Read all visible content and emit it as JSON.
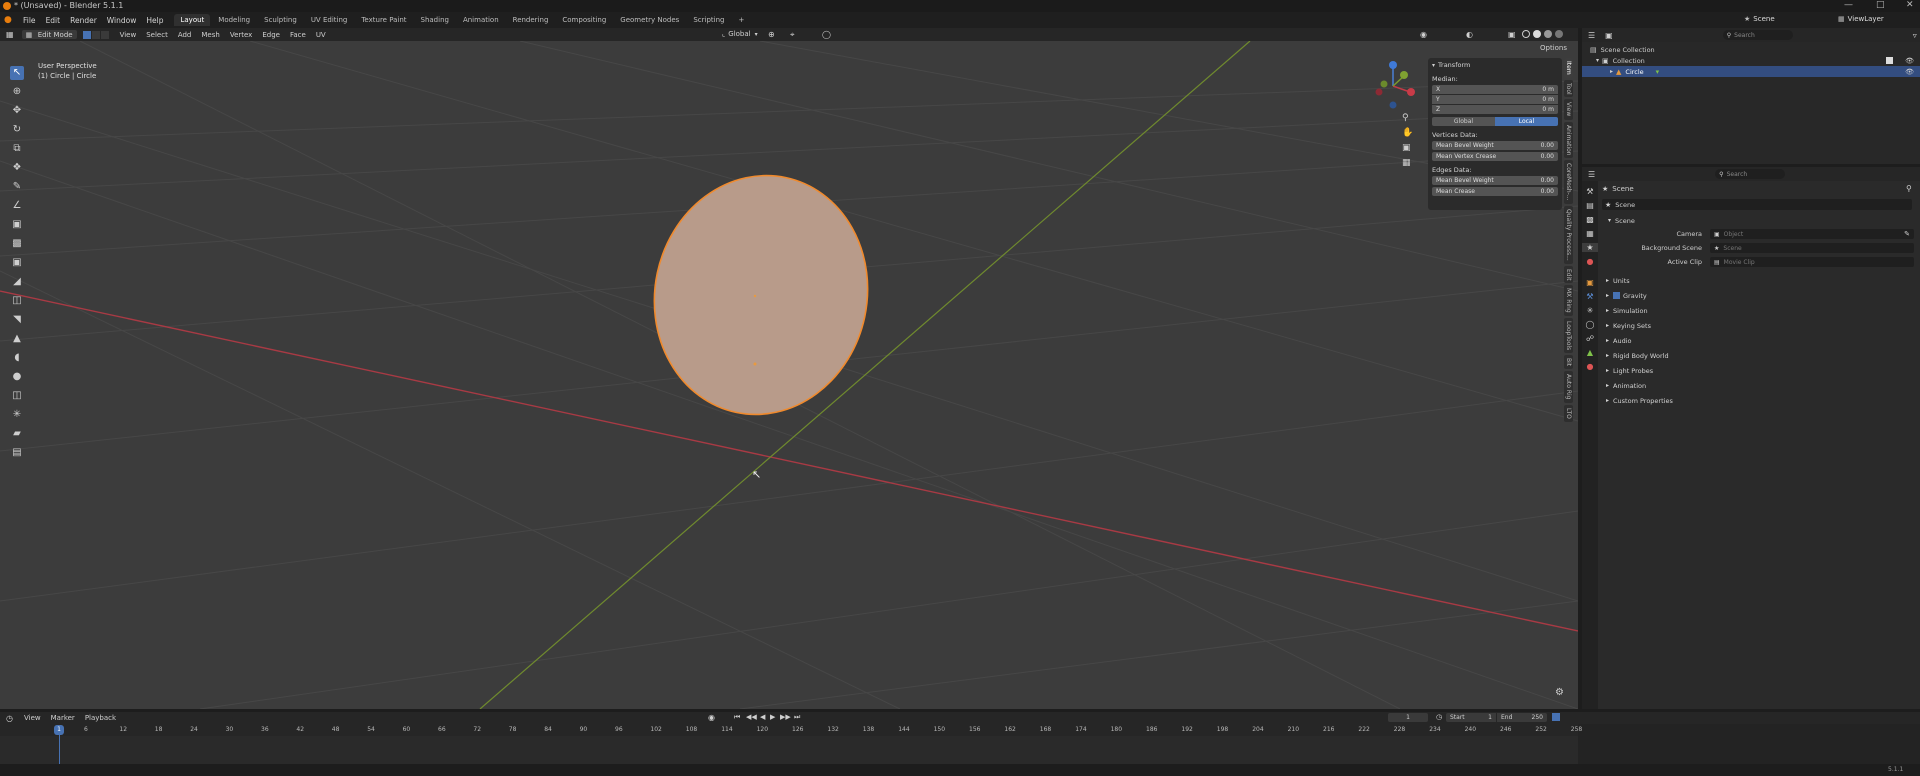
{
  "title": "* (Unsaved) - Blender 5.1.1",
  "menu": [
    "File",
    "Edit",
    "Render",
    "Window",
    "Help"
  ],
  "workspaces": [
    "Layout",
    "Modeling",
    "Sculpting",
    "UV Editing",
    "Texture Paint",
    "Shading",
    "Animation",
    "Rendering",
    "Compositing",
    "Geometry Nodes",
    "Scripting"
  ],
  "scene_field": "Scene",
  "viewlayer_field": "ViewLayer",
  "viewport_header": {
    "mode": "Edit Mode",
    "menus": [
      "View",
      "Select",
      "Add",
      "Mesh",
      "Vertex",
      "Edge",
      "Face",
      "UV"
    ],
    "orientation": "Global",
    "options": "Options"
  },
  "viewport_info": {
    "perspective": "User Perspective",
    "object": "(1) Circle | Circle"
  },
  "npanel": {
    "header": "Transform",
    "median": "Median:",
    "fields": [
      {
        "label": "X",
        "value": "0 m"
      },
      {
        "label": "Y",
        "value": "0 m"
      },
      {
        "label": "Z",
        "value": "0 m"
      }
    ],
    "global": "Global",
    "local": "Local",
    "vertices_data": "Vertices Data:",
    "mean_bevel_weight_v": "Mean Bevel Weight",
    "mean_vertex_crease": "Mean Vertex Crease",
    "edges_data": "Edges Data:",
    "mean_bevel_weight_e": "Mean Bevel Weight",
    "mean_crease": "Mean Crease",
    "zero": "0.00"
  },
  "sidetabs": [
    "Item",
    "Tool",
    "View",
    "Animation",
    "CoreMesh-...",
    "Quality Process...",
    "Edit",
    "MX Ring",
    "LoopTools",
    "Bit",
    "Auto Rig",
    "LTO"
  ],
  "outliner": {
    "search": "Search",
    "scene_collection": "Scene Collection",
    "collection": "Collection",
    "circle": "Circle"
  },
  "properties": {
    "search": "Search",
    "breadcrumb": "Scene",
    "scene_name": "Scene",
    "panel_scene": "Scene",
    "camera_label": "Camera",
    "camera_value": "Object",
    "bg_label": "Background Scene",
    "bg_value": "Scene",
    "clip_label": "Active Clip",
    "clip_value": "Movie Clip",
    "sections": [
      "Units",
      "Gravity",
      "Simulation",
      "Keying Sets",
      "Audio",
      "Rigid Body World",
      "Light Probes",
      "Animation",
      "Custom Properties"
    ]
  },
  "timeline": {
    "menus": [
      "View",
      "Marker",
      "Playback"
    ],
    "current_frame": "1",
    "start_label": "Start",
    "start": "1",
    "end_label": "End",
    "end": "250",
    "frames": [
      "6",
      "12",
      "18",
      "24",
      "30",
      "36",
      "42",
      "48",
      "54",
      "60",
      "66",
      "72",
      "78",
      "84",
      "90",
      "96",
      "102",
      "108",
      "114",
      "120",
      "126",
      "132",
      "138",
      "144",
      "150",
      "156",
      "162",
      "168",
      "174",
      "180",
      "186",
      "192",
      "198",
      "204",
      "210",
      "216",
      "222",
      "228",
      "234",
      "240",
      "246",
      "252",
      "258"
    ],
    "playhead": "1"
  },
  "version": "5.1.1",
  "colors": {
    "accent": "#4772b3",
    "mesh": "#b89b8a",
    "edge": "#f08a2d",
    "xaxis": "#c23a46",
    "yaxis": "#7a9a2e"
  }
}
